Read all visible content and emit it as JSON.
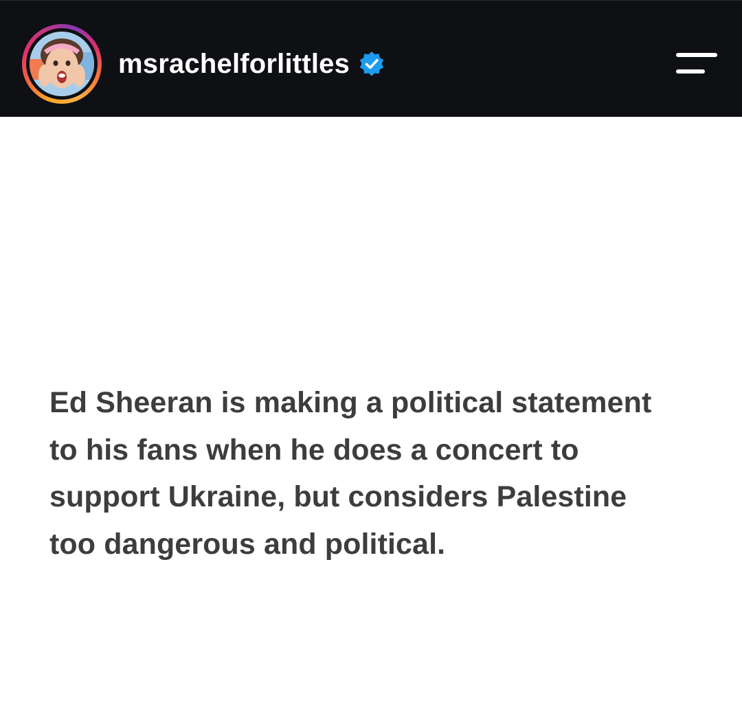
{
  "header": {
    "username": "msrachelforlittles",
    "verified_icon": "verified-badge-icon",
    "menu_icon": "hamburger-menu-icon",
    "colors": {
      "bar_background": "#0e1014",
      "username": "#ffffff",
      "verified_badge": "#1d9bf0"
    }
  },
  "post": {
    "lines": [
      "Ed Sheeran is making a political statement",
      "to his fans when he does a concert to",
      "support Ukraine, but considers Palestine",
      "too dangerous and political."
    ],
    "colors": {
      "background": "#ffffff",
      "text": "#3d3d3d"
    }
  }
}
